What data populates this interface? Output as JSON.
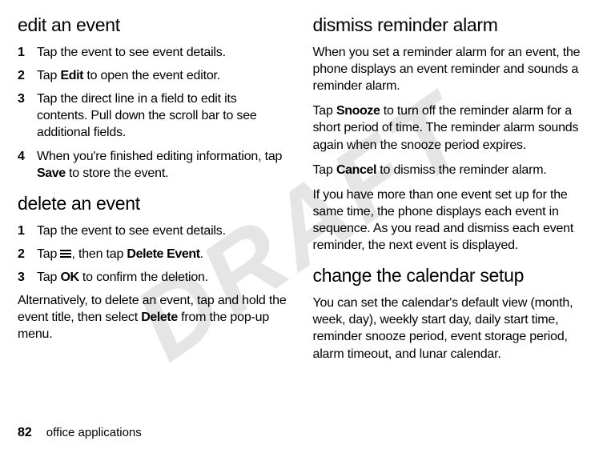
{
  "watermark": "DRAFT",
  "left": {
    "section1": {
      "title": "edit an event",
      "steps": [
        {
          "num": "1",
          "text": "Tap the event to see event details."
        },
        {
          "num": "2",
          "pre": "Tap ",
          "bold": "Edit",
          "post": " to open the event editor."
        },
        {
          "num": "3",
          "text": "Tap the direct line in a field to edit its contents. Pull down the scroll bar to see additional fields."
        },
        {
          "num": "4",
          "pre": "When you're finished editing information, tap ",
          "bold": "Save",
          "post": " to store the event."
        }
      ]
    },
    "section2": {
      "title": "delete an event",
      "steps": [
        {
          "num": "1",
          "text": "Tap the event to see event details."
        },
        {
          "num": "2",
          "pre": "Tap ",
          "icon": "menu",
          "mid": ", then tap ",
          "bold": "Delete Event",
          "post": "."
        },
        {
          "num": "3",
          "pre": "Tap ",
          "bold": "OK",
          "post": " to confirm the deletion."
        }
      ],
      "para_pre": "Alternatively, to delete an event, tap and hold the event title, then select ",
      "para_bold": "Delete",
      "para_post": " from the pop-up menu."
    }
  },
  "right": {
    "section1": {
      "title": "dismiss reminder alarm",
      "p1": "When you set a reminder alarm for an event, the phone displays an event reminder and sounds a reminder alarm.",
      "p2_pre": "Tap ",
      "p2_bold": "Snooze",
      "p2_post": " to turn off the reminder alarm for a short period of time. The reminder alarm sounds again when the snooze period expires.",
      "p3_pre": "Tap ",
      "p3_bold": "Cancel",
      "p3_post": " to dismiss the reminder alarm.",
      "p4": "If you have more than one event set up for the same time, the phone displays each event in sequence. As you read and dismiss each event reminder, the next event is displayed."
    },
    "section2": {
      "title": "change the calendar setup",
      "p1": "You can set the calendar's default view (month, week, day), weekly start day, daily start time, reminder snooze period, event storage period, alarm timeout, and lunar calendar."
    }
  },
  "footer": {
    "page": "82",
    "title": "office applications"
  }
}
